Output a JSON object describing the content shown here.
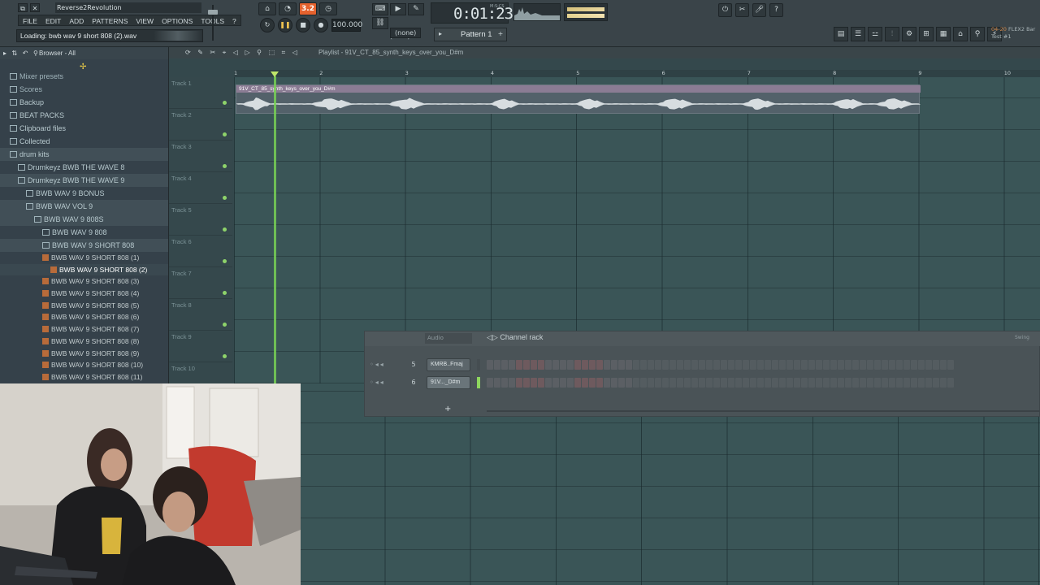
{
  "window": {
    "title": "Reverse2Revolution",
    "hint": "Loading: bwb wav 9 short 808 (2).wav",
    "controls": [
      "⧉",
      "✕"
    ]
  },
  "menu": [
    "FILE",
    "EDIT",
    "ADD",
    "PATTERNS",
    "VIEW",
    "OPTIONS",
    "TOOLS",
    "?"
  ],
  "transport": {
    "pat_song_indicator": "3.2",
    "tempo": "100.000",
    "time": "0:01",
    "time_frac": "23",
    "time_unit_label": "M:S:CS",
    "snap": "(none)",
    "pattern": "Pattern 1"
  },
  "news": {
    "line1": "04-20",
    "line1b": "FLEX2 Bar",
    "line2": "Test #1"
  },
  "browser": {
    "title": "Browser - All",
    "items": [
      {
        "label": "Mixer presets",
        "indent": 1,
        "type": "top"
      },
      {
        "label": "Scores",
        "indent": 1,
        "type": "top"
      },
      {
        "label": "Backup",
        "indent": 1,
        "type": "folder"
      },
      {
        "label": "BEAT PACKS",
        "indent": 1,
        "type": "folder"
      },
      {
        "label": "Clipboard files",
        "indent": 1,
        "type": "folder"
      },
      {
        "label": "Collected",
        "indent": 1,
        "type": "folder"
      },
      {
        "label": "drum kits",
        "indent": 1,
        "type": "folder",
        "sel": true
      },
      {
        "label": "Drumkeyz BWB THE WAVE 8",
        "indent": 2,
        "type": "folder"
      },
      {
        "label": "Drumkeyz BWB THE WAVE 9",
        "indent": 2,
        "type": "folder",
        "sel": true
      },
      {
        "label": "BWB WAV 9 BONUS",
        "indent": 3,
        "type": "folder"
      },
      {
        "label": "BWB WAV VOL 9",
        "indent": 3,
        "type": "folder",
        "sel": true
      },
      {
        "label": "BWB WAV 9 808S",
        "indent": 4,
        "type": "folder",
        "sel": true
      },
      {
        "label": "BWB WAV 9 808",
        "indent": 5,
        "type": "folder"
      },
      {
        "label": "BWB WAV 9 SHORT 808",
        "indent": 5,
        "type": "folder",
        "sel": true
      }
    ],
    "files": [
      {
        "label": "BWB WAV 9 SHORT 808 (1)"
      },
      {
        "label": "BWB WAV 9 SHORT 808 (2)",
        "active": true
      },
      {
        "label": "BWB WAV 9 SHORT 808 (3)"
      },
      {
        "label": "BWB WAV 9 SHORT 808 (4)"
      },
      {
        "label": "BWB WAV 9 SHORT 808 (5)"
      },
      {
        "label": "BWB WAV 9 SHORT 808 (6)"
      },
      {
        "label": "BWB WAV 9 SHORT 808 (7)"
      },
      {
        "label": "BWB WAV 9 SHORT 808 (8)"
      },
      {
        "label": "BWB WAV 9 SHORT 808 (9)"
      },
      {
        "label": "BWB WAV 9 SHORT 808 (10)"
      },
      {
        "label": "BWB WAV 9 SHORT 808 (11)"
      }
    ]
  },
  "playlist": {
    "title": "Playlist - 91V_CT_85_synth_keys_over_you_D#m",
    "bar_numbers": [
      "1",
      "2",
      "3",
      "4",
      "5",
      "6",
      "7",
      "8",
      "9",
      "10"
    ],
    "tracks": [
      "Track 1",
      "Track 2",
      "Track 3",
      "Track 4",
      "Track 5",
      "Track 6",
      "Track 7",
      "Track 8",
      "Track 9",
      "Track 10"
    ],
    "clip_name": "91V_CT_85_synth_keys_over_you_D#m",
    "playhead_bar": 1.45
  },
  "channel_rack": {
    "title": "Channel rack",
    "group": "Audio",
    "swing": "Swing",
    "channels": [
      {
        "num": "5",
        "name": "KMRB..Fmaj",
        "selected": false
      },
      {
        "num": "6",
        "name": "91V..._D#m",
        "selected": true
      }
    ],
    "add_label": "+"
  }
}
